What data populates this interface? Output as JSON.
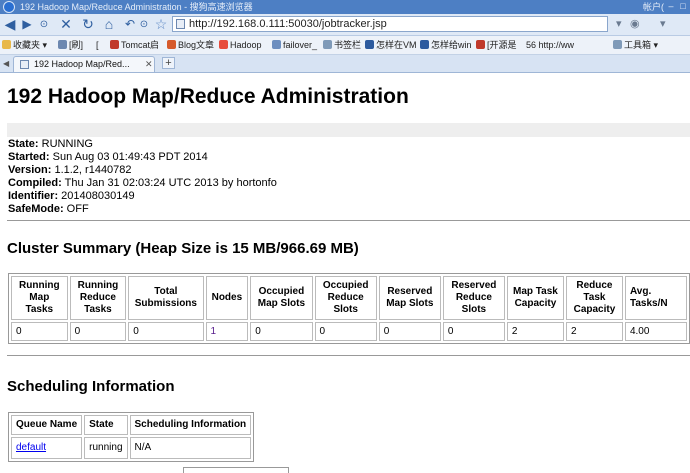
{
  "browser": {
    "window_title": "192 Hadoop Map/Reduce Administration - 搜狗高速浏览器",
    "titlebar_right": "帐户(",
    "url": "http://192.168.0.111:50030/jobtracker.jsp",
    "bookmarks": [
      {
        "label": "收藏夹 ▾",
        "color": "#e8b84a"
      },
      {
        "label": "[刷]",
        "color": "#6d88b0"
      },
      {
        "label": "[",
        "color": "#c8d4e6"
      },
      {
        "label": "Tomcat启",
        "color": "#c0392b"
      },
      {
        "label": "Blog文章",
        "color": "#d65a2b"
      },
      {
        "label": "Hadoop",
        "color": "#e74c3c"
      },
      {
        "label": "failover_",
        "color": "#6c8ebf"
      },
      {
        "label": "书签栏",
        "color": "#7f9ab8"
      },
      {
        "label": "怎样在VM",
        "color": "#2c5a9e"
      },
      {
        "label": "怎样给win",
        "color": "#2c5a9e"
      },
      {
        "label": "[开源是",
        "color": "#c0392b"
      },
      {
        "label": "56 http://ww",
        "color": "#e74c3c"
      },
      {
        "label": "工具箱 ▾",
        "color": "#7f9ab8"
      }
    ],
    "tab_label": "192 Hadoop Map/Red...",
    "icons": [
      "back-icon",
      "forward-icon",
      "dropdown-icon",
      "stop-icon",
      "refresh-icon",
      "home-icon",
      "restore-tabs-icon",
      "favorite-icon",
      "page-icon",
      "tab-close-icon",
      "new-tab-icon"
    ]
  },
  "page": {
    "title": "192 Hadoop Map/Reduce Administration",
    "info": [
      {
        "label": "State:",
        "value": " RUNNING"
      },
      {
        "label": "Started:",
        "value": " Sun Aug 03 01:49:43 PDT 2014"
      },
      {
        "label": "Version:",
        "value": " 1.1.2, r1440782"
      },
      {
        "label": "Compiled:",
        "value": " Thu Jan 31 02:03:24 UTC 2013 by hortonfo"
      },
      {
        "label": "Identifier:",
        "value": " 201408030149"
      },
      {
        "label": "SafeMode:",
        "value": " OFF"
      }
    ],
    "cluster_summary": {
      "title": "Cluster Summary (Heap Size is 15 MB/966.69 MB)",
      "headers": [
        "Running Map Tasks",
        "Running Reduce Tasks",
        "Total Submissions",
        "Nodes",
        "Occupied Map Slots",
        "Occupied Reduce Slots",
        "Reserved Map Slots",
        "Reserved Reduce Slots",
        "Map Task Capacity",
        "Reduce Task Capacity",
        "Avg. Tasks/N"
      ],
      "values": [
        "0",
        "0",
        "0",
        "1",
        "0",
        "0",
        "0",
        "0",
        "2",
        "2",
        "4.00"
      ]
    },
    "scheduling": {
      "title": "Scheduling Information",
      "headers": [
        "Queue Name",
        "State",
        "Scheduling Information"
      ],
      "rows": [
        [
          "default",
          "running",
          "N/A"
        ]
      ]
    }
  }
}
